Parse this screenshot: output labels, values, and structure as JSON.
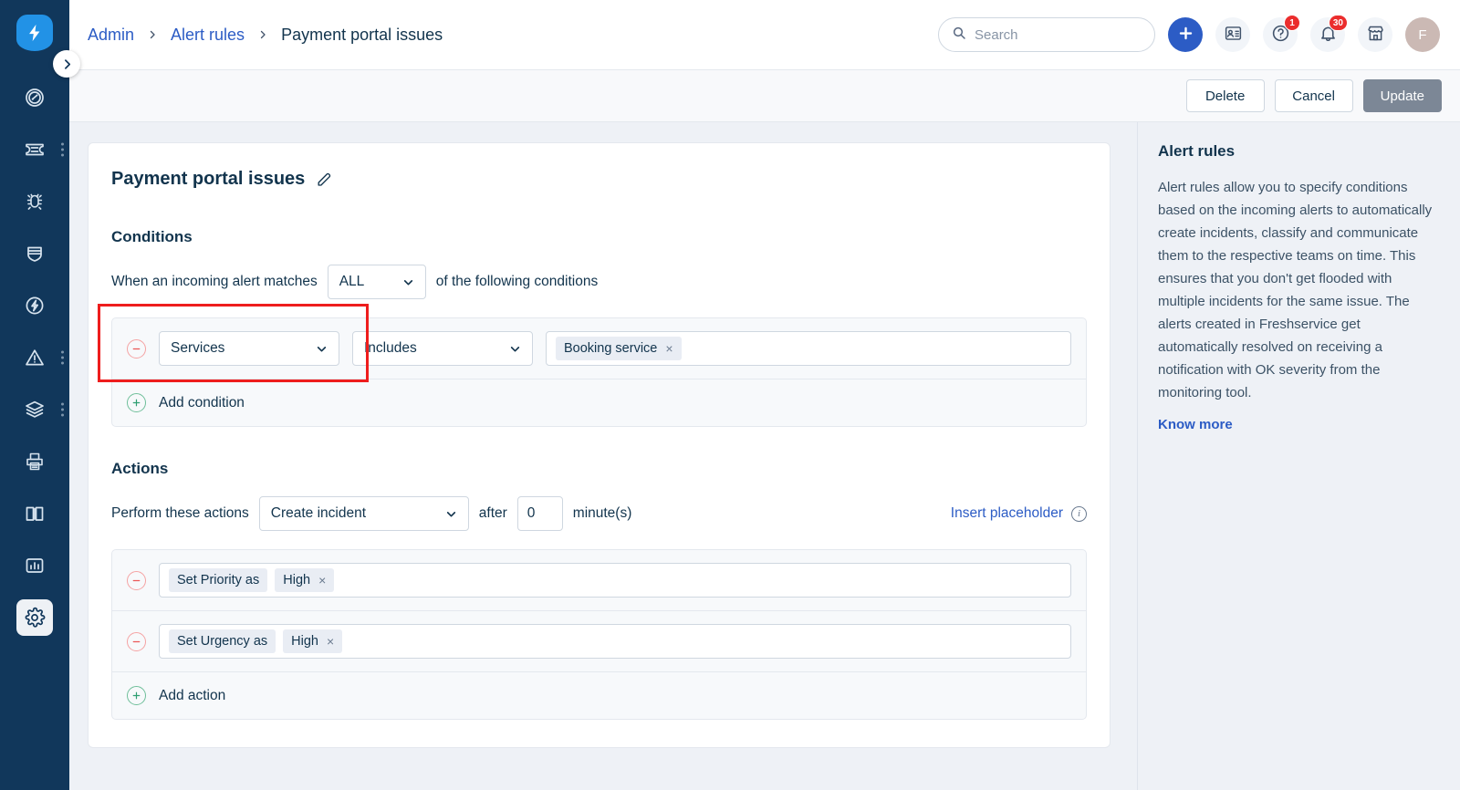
{
  "app": {
    "logo_icon": "freshservice-bolt-logo",
    "expand_icon": "chevron-right-icon"
  },
  "sidebar": {
    "items": [
      {
        "icon": "dashboard-gauge-icon",
        "name": "dashboard",
        "has_menu": false,
        "active": false
      },
      {
        "icon": "ticket-icon",
        "name": "tickets",
        "has_menu": true,
        "active": false
      },
      {
        "icon": "bug-icon",
        "name": "problems",
        "has_menu": false,
        "active": false
      },
      {
        "icon": "shield-icon",
        "name": "changes",
        "has_menu": false,
        "active": false
      },
      {
        "icon": "bolt-circle-icon",
        "name": "releases",
        "has_menu": false,
        "active": false
      },
      {
        "icon": "alert-triangle-icon",
        "name": "alerts",
        "has_menu": true,
        "active": false
      },
      {
        "icon": "layers-icon",
        "name": "assets",
        "has_menu": true,
        "active": false
      },
      {
        "icon": "purchase-order-icon",
        "name": "purchase",
        "has_menu": false,
        "active": false
      },
      {
        "icon": "book-icon",
        "name": "solutions",
        "has_menu": false,
        "active": false
      },
      {
        "icon": "chart-bar-icon",
        "name": "analytics",
        "has_menu": false,
        "active": false
      },
      {
        "icon": "gear-icon",
        "name": "admin",
        "has_menu": false,
        "active": true
      }
    ]
  },
  "header": {
    "breadcrumb": [
      {
        "label": "Admin",
        "is_link": true
      },
      {
        "label": "Alert rules",
        "is_link": true
      },
      {
        "label": "Payment portal issues",
        "is_link": false
      }
    ],
    "search": {
      "value": "",
      "placeholder": "Search",
      "icon": "search-icon"
    },
    "actions": [
      {
        "name": "new-item-button",
        "icon": "plus-icon",
        "badge": ""
      },
      {
        "name": "contacts-button",
        "icon": "contact-card-icon",
        "badge": ""
      },
      {
        "name": "help-button",
        "icon": "question-circle-icon",
        "badge": "1"
      },
      {
        "name": "notifications-button",
        "icon": "bell-icon",
        "badge": "30"
      },
      {
        "name": "marketplace-button",
        "icon": "marketplace-store-icon",
        "badge": ""
      }
    ],
    "avatar": {
      "initial": "F"
    }
  },
  "toolbar": {
    "delete_label": "Delete",
    "cancel_label": "Cancel",
    "update_label": "Update",
    "update_disabled": true
  },
  "rule": {
    "title": "Payment portal issues",
    "edit_icon": "pencil-icon",
    "conditions": {
      "heading": "Conditions",
      "prefix_label": "When an incoming alert matches",
      "match_type": "ALL",
      "suffix_label": "of the following conditions",
      "rows": [
        {
          "remove_icon": "minus-circle-icon",
          "field": "Services",
          "operator": "Includes",
          "values": [
            {
              "label": "Booking service",
              "remove": "×"
            }
          ]
        }
      ],
      "add_label": "Add condition",
      "add_icon": "plus-circle-icon"
    },
    "actions": {
      "heading": "Actions",
      "prefix_label": "Perform these actions",
      "action_type": "Create incident",
      "after_label": "after",
      "delay_value": "0",
      "delay_placeholder": "0",
      "minutes_label": "minute(s)",
      "placeholder_link": "Insert placeholder",
      "info_icon": "info-circle-icon",
      "rows": [
        {
          "remove_icon": "minus-circle-icon",
          "name_chip": "Set Priority as",
          "value_chip": "High",
          "value_remove": "×"
        },
        {
          "remove_icon": "minus-circle-icon",
          "name_chip": "Set Urgency as",
          "value_chip": "High",
          "value_remove": "×"
        }
      ],
      "add_label": "Add action",
      "add_icon": "plus-circle-icon"
    }
  },
  "help_panel": {
    "title": "Alert rules",
    "body": "Alert rules allow you to specify conditions based on the incoming alerts to automatically create incidents, classify and communicate them to the respective teams on time. This ensures that you don't get flooded with multiple incidents for the same issue. The alerts created in Freshservice get automatically resolved on receiving a notification with OK severity from the monitoring tool.",
    "link_label": "Know more"
  },
  "annotation": {
    "color": "#ee1d1d",
    "target": "services-field-select"
  },
  "colors": {
    "rail_bg": "#11375b",
    "brand_blue": "#2c5cc5",
    "logo_blue": "#2292e6",
    "page_bg": "#eef1f6",
    "text_dark": "#12344d",
    "badge_red": "#eb2d2d",
    "disabled_gray": "#7c8796",
    "annotation_red": "#ee1d1d"
  }
}
